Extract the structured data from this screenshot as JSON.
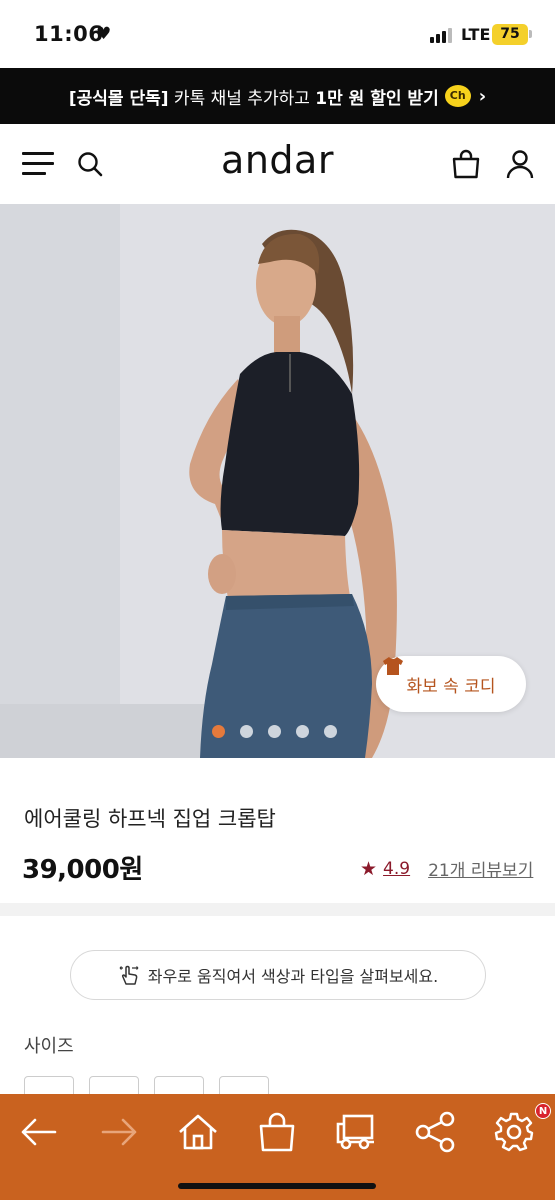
{
  "status_bar": {
    "time": "11:06",
    "heart": "♥",
    "network": "LTE",
    "battery": "75"
  },
  "promo": {
    "tag": "[공식몰 단독]",
    "text_a": " 카톡 채널 추가하고 ",
    "highlight": "1만 원 할인 받기",
    "ch_icon": "Ch",
    "chevron": "›"
  },
  "header": {
    "logo": "andar",
    "icons": [
      "menu-icon",
      "search-icon",
      "shopping-bag-icon",
      "user-icon"
    ]
  },
  "hero": {
    "coordi_label": "화보 속 코디",
    "carousel_total": 5,
    "carousel_active": 1
  },
  "product": {
    "name": "에어쿨링 하프넥 집업 크롭탑",
    "price": "39,000원",
    "star": "★",
    "rating": "4.9",
    "reviews_link": "21개 리뷰보기"
  },
  "options": {
    "hint": "좌우로 움직여서 색상과 타입을 살펴보세요.",
    "size_label": "사이즈"
  },
  "bottom_bar": {
    "icons": [
      "back-arrow-icon",
      "forward-arrow-icon",
      "home-icon",
      "shopping-bag-icon",
      "delivery-truck-icon",
      "share-icon",
      "settings-gear-icon"
    ],
    "badge": "N",
    "color": "#c9621f"
  },
  "colors": {
    "accent_orange": "#e57a3c",
    "rating_red": "#8b1a2b",
    "coordi_text": "#b5541e"
  }
}
